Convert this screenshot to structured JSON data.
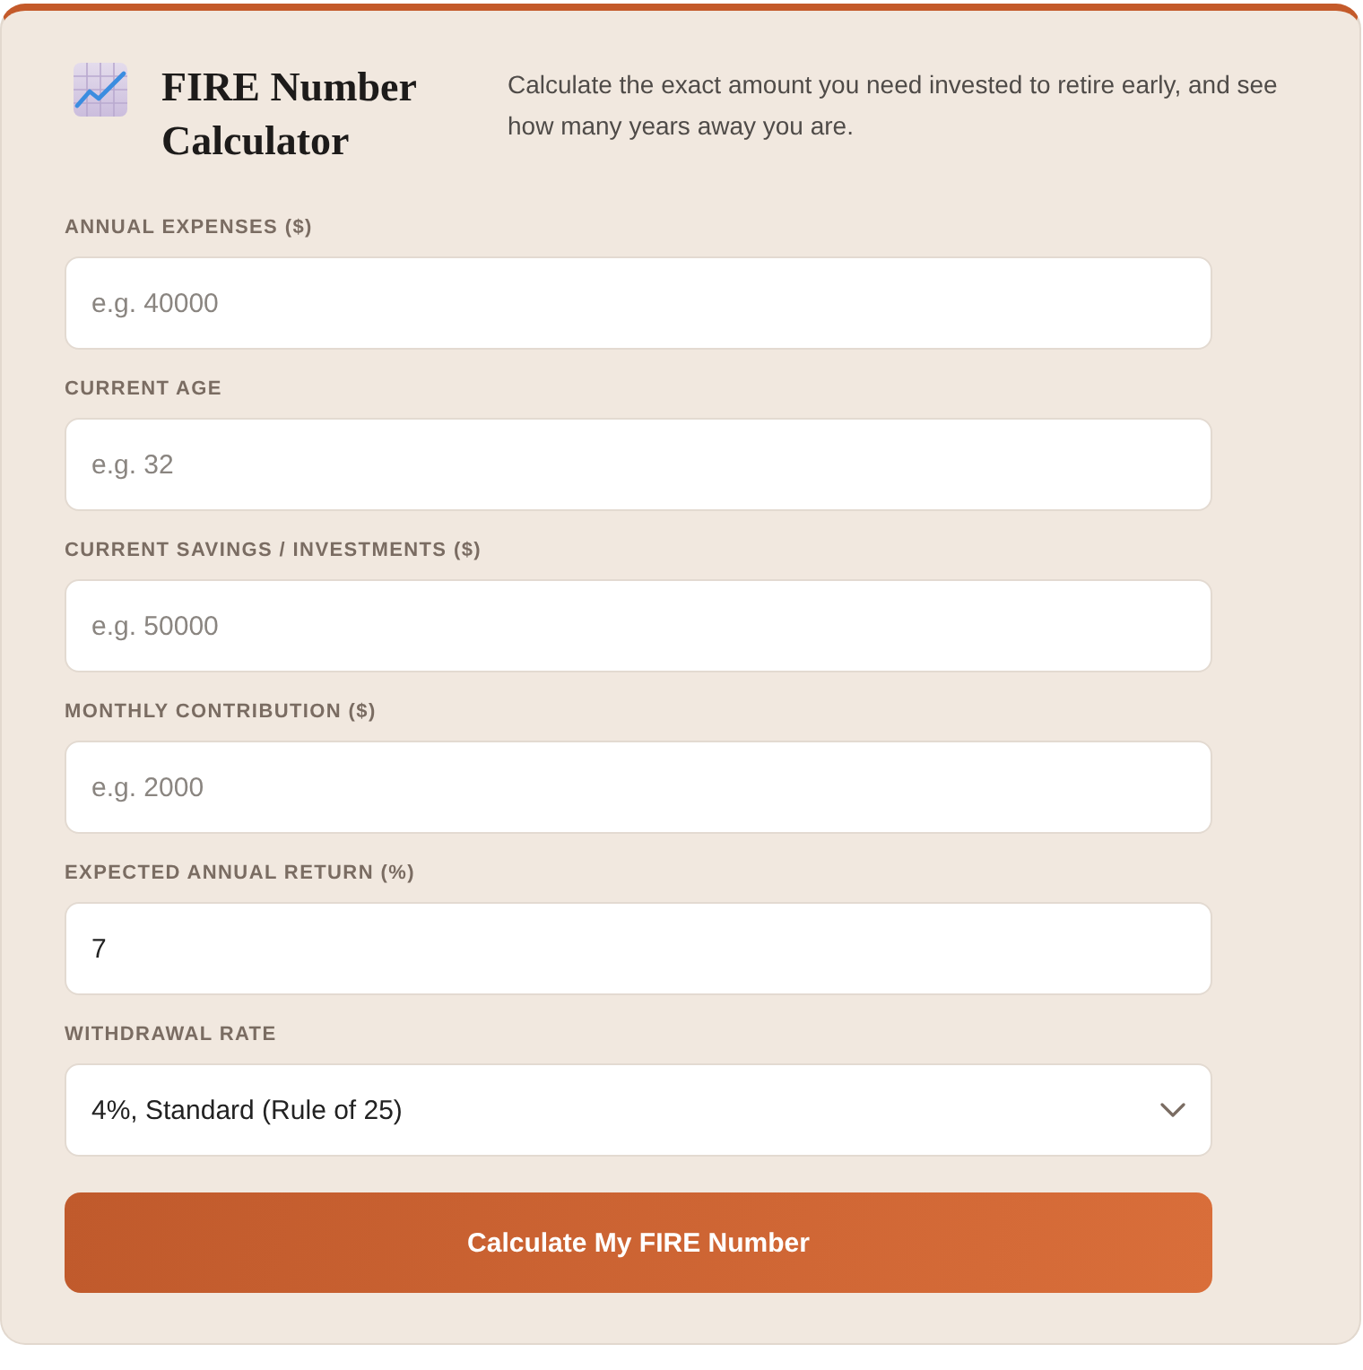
{
  "header": {
    "title": "FIRE Number Calculator",
    "description": "Calculate the exact amount you need invested to retire early, and see how many years away you are."
  },
  "fields": [
    {
      "kind": "input",
      "label": "ANNUAL EXPENSES ($)",
      "placeholder": "e.g. 40000"
    },
    {
      "kind": "input",
      "label": "CURRENT AGE",
      "placeholder": "e.g. 32"
    },
    {
      "kind": "input",
      "label": "CURRENT SAVINGS / INVESTMENTS ($)",
      "placeholder": "e.g. 50000"
    },
    {
      "kind": "input",
      "label": "MONTHLY CONTRIBUTION ($)",
      "placeholder": "e.g. 2000"
    },
    {
      "kind": "input",
      "label": "EXPECTED ANNUAL RETURN (%)",
      "value": "7"
    },
    {
      "kind": "select",
      "label": "WITHDRAWAL RATE",
      "value": "4%, Standard (Rule of 25)"
    }
  ],
  "submit_button": {
    "label": "Calculate My FIRE Number"
  }
}
